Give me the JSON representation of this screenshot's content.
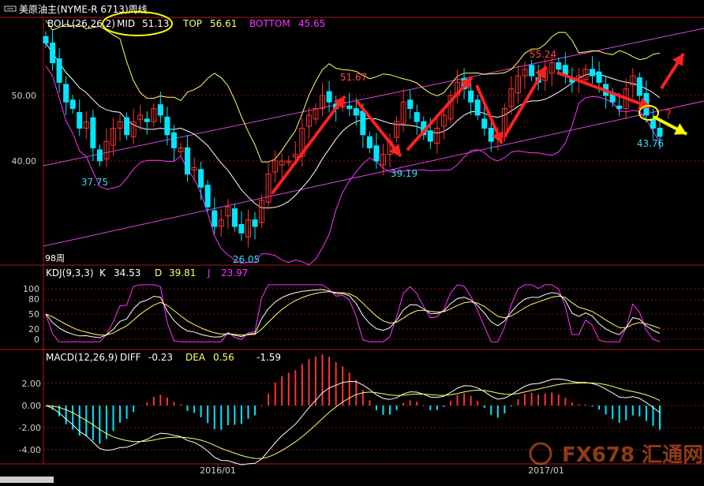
{
  "title_bar": {
    "text": "美原油主(NYME-R 6713)周线"
  },
  "boll": {
    "label": "BOLL(26,26,2)",
    "mid_label": "MID",
    "mid_value": "51.13",
    "top_label": "TOP",
    "top_value": "56.61",
    "bottom_label": "BOTTOM",
    "bottom_value": "45.65"
  },
  "kdj": {
    "label": "KDJ(9,3,3)",
    "k_label": "K",
    "k_value": "34.53",
    "d_label": "D",
    "d_value": "39.81",
    "j_label": "J",
    "j_value": "23.97"
  },
  "macd": {
    "label": "MACD(12,26,9)",
    "diff_label": "DIFF",
    "diff_value": "-0.23",
    "dea_label": "DEA",
    "dea_value": "0.56",
    "macd_value": "-1.59"
  },
  "price_axis_labels": [
    "50.00",
    "40.00"
  ],
  "kdj_axis_labels": [
    "100",
    "80",
    "50",
    "20",
    "0"
  ],
  "macd_axis_labels": [
    "2.00",
    "0.00",
    "-2.00",
    "-4.00"
  ],
  "date_labels": [
    "2016/01",
    "2017/01"
  ],
  "annotations": {
    "p1": "37.75",
    "p2": "26.05",
    "p3": "51.67",
    "p4": "39.19",
    "p5": "55.24",
    "p6": "43.76",
    "count": "98周",
    "question": "?"
  },
  "watermark": {
    "text": "FX678 汇通网"
  },
  "colors": {
    "up": "#ff3232",
    "down": "#00e6ff",
    "mid": "#ffffff",
    "top": "#ffff66",
    "bottom": "#ff33ff",
    "channel": "#dd44dd",
    "arrow": "#ff2020"
  },
  "chart_data": [
    {
      "type": "candlestick",
      "title": "美原油主(NYME-R 6713)周线",
      "ylim": [
        25,
        62
      ],
      "x_tick_labels": [
        "2016/01",
        "2017/01"
      ],
      "closes": [
        58,
        55,
        52,
        49,
        48,
        45,
        46,
        42,
        40,
        43,
        45,
        46,
        44,
        46,
        47,
        46,
        48,
        47,
        44,
        42,
        42,
        38,
        39,
        36,
        33,
        30,
        31,
        33,
        30,
        29,
        31,
        30,
        34,
        38,
        40,
        40,
        40,
        41,
        45,
        47,
        48,
        50,
        49,
        48,
        49,
        48,
        47,
        44,
        42,
        40,
        41,
        43,
        46,
        49,
        48,
        46,
        44,
        43,
        45,
        47,
        50,
        52,
        51,
        49,
        47,
        45,
        43,
        44,
        48,
        51,
        53,
        54,
        53,
        52,
        54,
        55,
        54,
        53,
        52,
        53,
        54,
        53,
        52,
        50,
        49,
        48,
        51,
        53,
        50,
        47,
        45,
        43.76
      ],
      "series": [
        {
          "name": "MID",
          "values": [
            51.13
          ]
        },
        {
          "name": "TOP",
          "values": [
            56.61
          ]
        },
        {
          "name": "BOTTOM",
          "values": [
            45.65
          ]
        }
      ],
      "annotations": [
        37.75,
        26.05,
        51.67,
        39.19,
        55.24,
        43.76
      ]
    },
    {
      "type": "line",
      "title": "KDJ(9,3,3)",
      "ylim": [
        0,
        100
      ],
      "series": [
        {
          "name": "K",
          "values": [
            34.53
          ]
        },
        {
          "name": "D",
          "values": [
            39.81
          ]
        },
        {
          "name": "J",
          "values": [
            23.97
          ]
        }
      ]
    },
    {
      "type": "bar",
      "title": "MACD(12,26,9)",
      "ylim": [
        -5,
        3.5
      ],
      "series": [
        {
          "name": "DIFF",
          "values": [
            -0.23
          ]
        },
        {
          "name": "DEA",
          "values": [
            0.56
          ]
        },
        {
          "name": "MACD",
          "values": [
            -1.59
          ]
        }
      ]
    }
  ]
}
